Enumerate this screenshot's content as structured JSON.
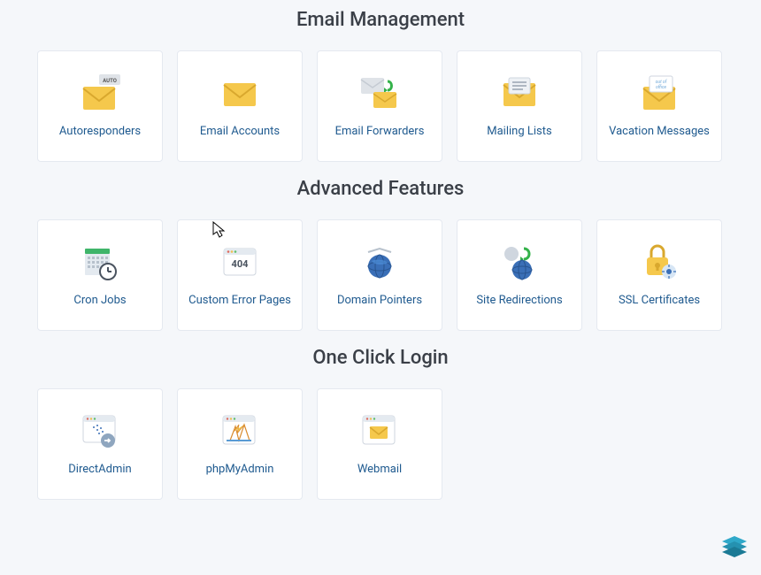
{
  "sections": [
    {
      "title": "Email Management",
      "items": [
        {
          "label": "Autoresponders",
          "icon": "autoresponders"
        },
        {
          "label": "Email Accounts",
          "icon": "email-accounts"
        },
        {
          "label": "Email Forwarders",
          "icon": "email-forwarders"
        },
        {
          "label": "Mailing Lists",
          "icon": "mailing-lists"
        },
        {
          "label": "Vacation Messages",
          "icon": "vacation-messages"
        }
      ]
    },
    {
      "title": "Advanced Features",
      "items": [
        {
          "label": "Cron Jobs",
          "icon": "cron-jobs"
        },
        {
          "label": "Custom Error Pages",
          "icon": "custom-error-pages"
        },
        {
          "label": "Domain Pointers",
          "icon": "domain-pointers"
        },
        {
          "label": "Site Redirections",
          "icon": "site-redirections"
        },
        {
          "label": "SSL Certificates",
          "icon": "ssl-certificates"
        }
      ]
    },
    {
      "title": "One Click Login",
      "items": [
        {
          "label": "DirectAdmin",
          "icon": "directadmin"
        },
        {
          "label": "phpMyAdmin",
          "icon": "phpmyadmin"
        },
        {
          "label": "Webmail",
          "icon": "webmail"
        }
      ]
    }
  ]
}
